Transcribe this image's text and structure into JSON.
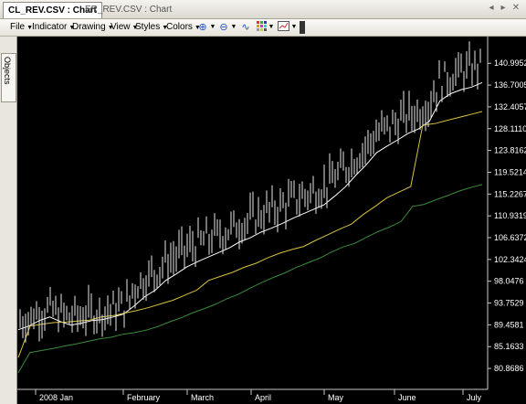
{
  "tabs": [
    {
      "label": "CL_REV.CSV : Chart",
      "active": true
    },
    {
      "label": "ER_REV.CSV : Chart",
      "active": false
    }
  ],
  "tab_controls": {
    "left_icon": "chevron-left-icon",
    "right_icon": "chevron-right-icon",
    "close_icon": "close-icon"
  },
  "menu": [
    {
      "label": "File"
    },
    {
      "label": "Indicator"
    },
    {
      "label": "Drawing"
    },
    {
      "label": "View"
    },
    {
      "label": "Styles"
    },
    {
      "label": "Colors"
    }
  ],
  "toolbar_icons": [
    "zoom-in-icon",
    "zoom-out-icon",
    "line-style-icon",
    "grid-icon",
    "chart-type-icon"
  ],
  "sidebar": {
    "tab_label": "Objects"
  },
  "chart_data": {
    "type": "line",
    "subtype": "ohlc-with-indicators",
    "background": "#000000",
    "y_ticks": [
      "140.9952",
      "136.7005",
      "132.4057",
      "128.1110",
      "123.8162",
      "119.5214",
      "115.2267",
      "110.9319",
      "106.6372",
      "102.3424",
      "98.0476",
      "93.7529",
      "89.4581",
      "85.1633",
      "80.8686"
    ],
    "x_ticks": [
      "2008 Jan",
      "February",
      "March",
      "April",
      "May",
      "June",
      "July"
    ],
    "ylim": [
      78,
      145
    ],
    "colors": {
      "price": "#ffffff",
      "upper": "#d7c13c",
      "lower": "#3b8a3b",
      "bars": "#e8e8e8",
      "axis_text": "#ffffff"
    },
    "series": [
      {
        "values": [
          88.5,
          89.2,
          90.3,
          91.0,
          90.1,
          89.4,
          89.8,
          90.3,
          90.5,
          91.0,
          91.6,
          93.2,
          95.0,
          96.3,
          98.2,
          99.5,
          100.9,
          101.9,
          102.8,
          103.7,
          104.6,
          105.8,
          106.6,
          107.7,
          108.5,
          109.4,
          110.4,
          111.3,
          112.2,
          113.1,
          114.8,
          116.6,
          118.9,
          121.0,
          123.4,
          124.7,
          125.9,
          127.2,
          128.1,
          129.6,
          133.6,
          135.0,
          135.8,
          136.3,
          137.2
        ]
      },
      {
        "values": [
          83.0,
          89.2,
          89.6,
          89.9,
          90.0,
          90.2,
          90.4,
          91.0,
          91.3,
          91.8,
          92.3,
          92.9,
          93.6,
          94.3,
          95.3,
          96.3,
          98.2,
          99.0,
          99.8,
          100.8,
          101.6,
          102.7,
          103.6,
          104.3,
          104.9,
          106.1,
          107.2,
          108.3,
          109.3,
          111.2,
          112.8,
          114.5,
          115.6,
          116.7,
          128.8,
          129.1,
          129.7,
          130.3,
          130.9,
          131.5
        ]
      },
      {
        "values": [
          80.0,
          84.0,
          84.4,
          84.8,
          85.3,
          85.7,
          86.2,
          86.7,
          87.0,
          87.6,
          87.9,
          88.4,
          89.1,
          90.0,
          90.8,
          91.8,
          92.6,
          93.5,
          94.6,
          95.5,
          96.7,
          97.8,
          98.8,
          99.7,
          100.8,
          101.7,
          102.6,
          103.8,
          104.8,
          105.5,
          106.7,
          107.8,
          108.7,
          109.8,
          112.8,
          113.2,
          114.1,
          114.9,
          115.8,
          116.5,
          117.1
        ]
      }
    ]
  }
}
